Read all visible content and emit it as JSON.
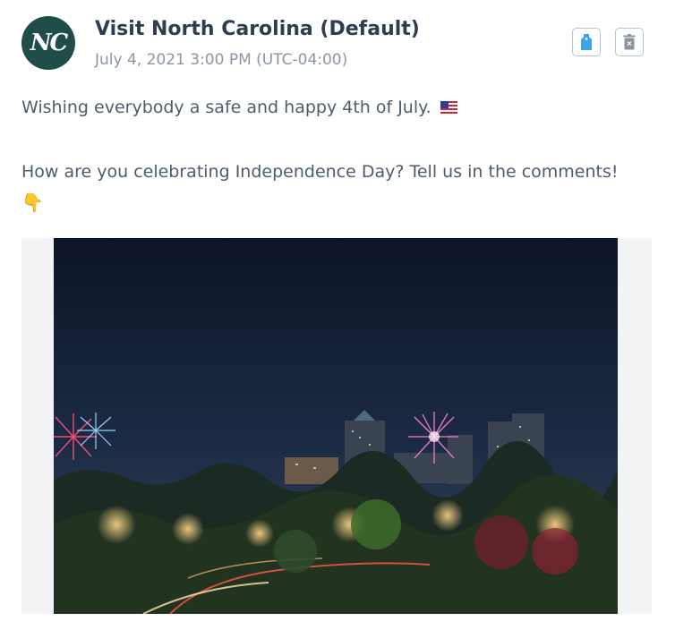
{
  "post": {
    "avatar_text": "NC",
    "account_name": "Visit North Carolina (Default)",
    "timestamp": "July 4, 2021 3:00 PM (UTC-04:00)",
    "caption_line1": "Wishing everybody a safe and happy 4th of July.",
    "caption_line1_emoji": "us-flag-icon",
    "caption_line2": "How are you celebrating Independence Day? Tell us in the comments!",
    "caption_line2_emoji": "👇",
    "media": {
      "type": "photo",
      "subject": "fireworks over city skyline at night"
    }
  },
  "actions": {
    "tag_icon": "tag-icon",
    "delete_icon": "trash-icon"
  },
  "colors": {
    "avatar_bg": "#1f4e4a",
    "title_text": "#2e3d52",
    "meta_text": "#8a96a3",
    "tag_icon": "#3aa6e8",
    "trash_icon": "#8c96a2",
    "media_bg": "#f2f3f5"
  }
}
